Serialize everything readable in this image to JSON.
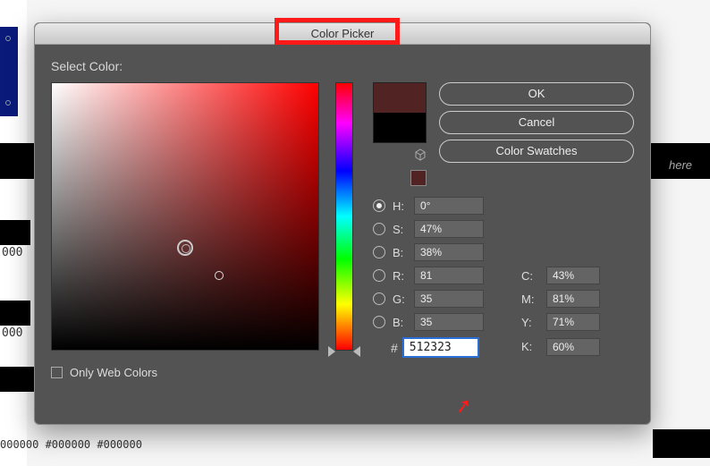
{
  "dialog": {
    "title": "Color Picker",
    "section_label": "Select Color:",
    "buttons": {
      "ok": "OK",
      "cancel": "Cancel",
      "swatches": "Color Swatches"
    },
    "swatch": {
      "new_hex": "#512323",
      "old_hex": "#000000"
    },
    "hsv": {
      "h_label": "H:",
      "h_value": "0°",
      "s_label": "S:",
      "s_value": "47%",
      "b_label": "B:",
      "b_value": "38%"
    },
    "rgb": {
      "r_label": "R:",
      "r_value": "81",
      "g_label": "G:",
      "g_value": "35",
      "b_label": "B:",
      "b_value": "35"
    },
    "cmyk": {
      "c_label": "C:",
      "c_value": "43%",
      "m_label": "M:",
      "m_value": "81%",
      "y_label": "Y:",
      "y_value": "71%",
      "k_label": "K:",
      "k_value": "60%"
    },
    "hex_label": "#",
    "hex_value": "512323",
    "only_web_label": "Only Web Colors"
  },
  "bg": {
    "here": "here",
    "cell": "000",
    "hashes": "000000          #000000          #000000"
  }
}
